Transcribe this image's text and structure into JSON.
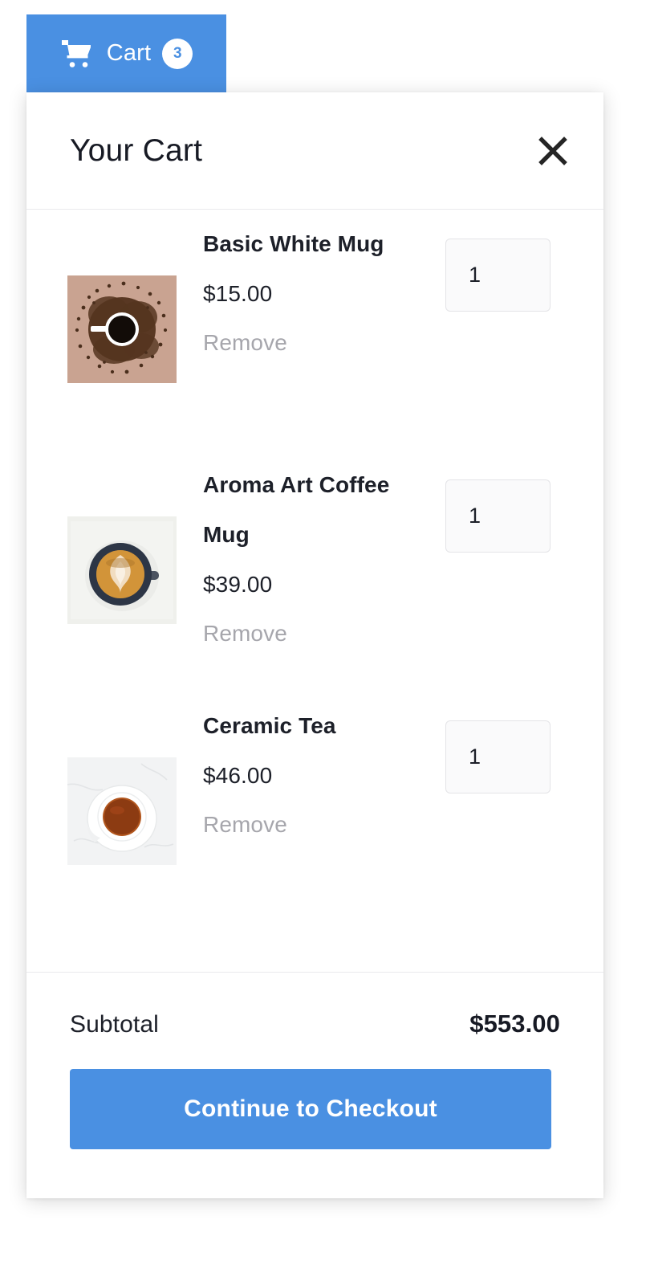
{
  "cart_tab": {
    "icon": "shopping-cart-icon",
    "label": "Cart",
    "badge_count": "3"
  },
  "panel": {
    "title": "Your Cart",
    "close_icon": "close-icon"
  },
  "items": [
    {
      "name": "Basic White Mug",
      "price": "$15.00",
      "remove_label": "Remove",
      "quantity": "1",
      "image": {
        "alt": "white-mug-on-coffee-beans-photo",
        "background": "#c9a391",
        "beans": "#5a3a28",
        "cup_rim": "#ffffff",
        "liquid": "#120c08"
      }
    },
    {
      "name": "Aroma Art Coffee Mug",
      "price": "$39.00",
      "remove_label": "Remove",
      "quantity": "1",
      "image": {
        "alt": "latte-art-in-navy-cup-photo",
        "background": "#eff0ec",
        "cup": "#2d3646",
        "liquid": "#d79a3f",
        "foam": "#f3e3cd"
      }
    },
    {
      "name": "Ceramic Tea",
      "price": "$46.00",
      "remove_label": "Remove",
      "quantity": "1",
      "image": {
        "alt": "white-teacup-with-tea-on-marble-photo",
        "background": "#f2f3f4",
        "saucer": "#ffffff",
        "liquid": "#8c3b12",
        "liquid_edge": "#b2561d"
      }
    }
  ],
  "footer": {
    "subtotal_label": "Subtotal",
    "subtotal_value": "$553.00",
    "checkout_label": "Continue to Checkout"
  },
  "colors": {
    "accent": "#4a90e2",
    "text": "#1d2029",
    "muted": "#a6a6ac",
    "divider": "#e9e9ec",
    "input_bg": "#fafafb"
  }
}
